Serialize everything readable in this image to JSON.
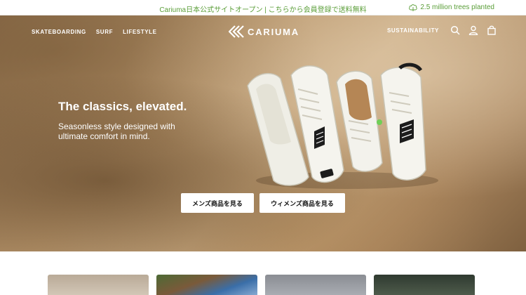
{
  "announcement": {
    "message": "Cariuma日本公式サイトオープン | こちらから会員登録で送料無料",
    "trees_label": "2.5 million trees planted"
  },
  "nav": {
    "left_items": [
      "SKATEBOARDING",
      "SURF",
      "LIFESTYLE"
    ],
    "logo_text": "CARIUMA",
    "sustainability": "SUSTAINABILITY",
    "icons": [
      "search-icon",
      "account-icon",
      "bag-icon"
    ]
  },
  "hero": {
    "headline": "The classics, elevated.",
    "subtext": "Seasonless style designed with ultimate comfort in mind.",
    "cta_men": "メンズ商品を見る",
    "cta_women": "ウィメンズ商品を見る"
  },
  "colors": {
    "accent_green": "#5a9e38",
    "hero_base": "#b8966c"
  },
  "thumbnails": [
    "thumb-1",
    "thumb-2",
    "thumb-3",
    "thumb-4"
  ]
}
